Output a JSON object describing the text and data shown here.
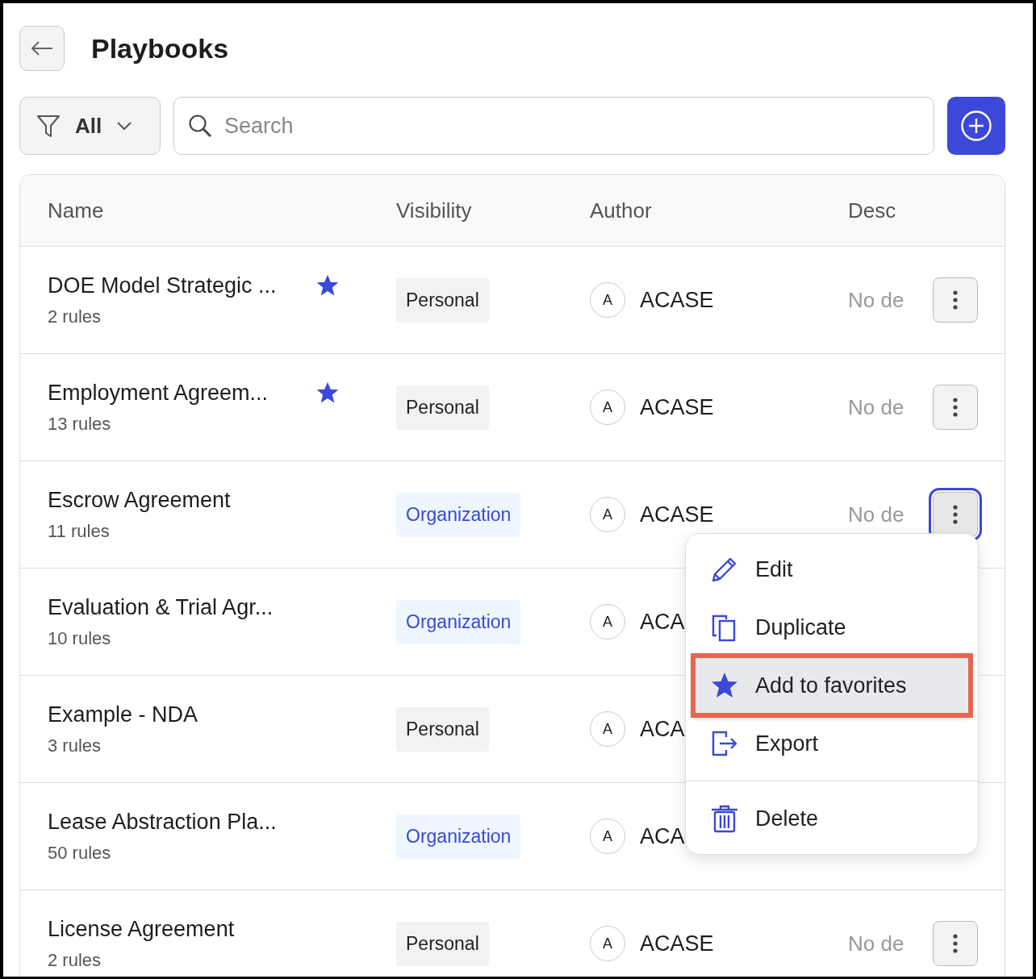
{
  "header": {
    "title": "Playbooks"
  },
  "toolbar": {
    "filter": {
      "label": "All"
    },
    "search": {
      "placeholder": "Search"
    }
  },
  "table": {
    "columns": [
      "Name",
      "Visibility",
      "Author",
      "Desc"
    ],
    "rows": [
      {
        "name": "DOE Model Strategic ...",
        "rules": "2 rules",
        "favorite": true,
        "visibility": {
          "label": "Personal",
          "kind": "personal"
        },
        "avatar": "A",
        "author": "ACASE",
        "description": "No de",
        "menu_button": true,
        "selected": false
      },
      {
        "name": "Employment Agreem...",
        "rules": "13 rules",
        "favorite": true,
        "visibility": {
          "label": "Personal",
          "kind": "personal"
        },
        "avatar": "A",
        "author": "ACASE",
        "description": "No de",
        "menu_button": true,
        "selected": false
      },
      {
        "name": "Escrow Agreement",
        "rules": "11 rules",
        "favorite": false,
        "visibility": {
          "label": "Organization",
          "kind": "organization"
        },
        "avatar": "A",
        "author": "ACASE",
        "description": "No de",
        "menu_button": true,
        "selected": true
      },
      {
        "name": "Evaluation & Trial Agr...",
        "rules": "10 rules",
        "favorite": false,
        "visibility": {
          "label": "Organization",
          "kind": "organization"
        },
        "avatar": "A",
        "author": "ACA",
        "menu_button": false
      },
      {
        "name": "Example - NDA",
        "rules": "3 rules",
        "favorite": false,
        "visibility": {
          "label": "Personal",
          "kind": "personal"
        },
        "avatar": "A",
        "author": "ACA",
        "menu_button": false
      },
      {
        "name": "Lease Abstraction Pla...",
        "rules": "50 rules",
        "favorite": false,
        "visibility": {
          "label": "Organization",
          "kind": "organization"
        },
        "avatar": "A",
        "author": "ACA",
        "menu_button": false
      },
      {
        "name": "License Agreement",
        "rules": "2 rules",
        "favorite": false,
        "visibility": {
          "label": "Personal",
          "kind": "personal"
        },
        "avatar": "A",
        "author": "ACASE",
        "description": "No de",
        "menu_button": true,
        "selected": false
      }
    ]
  },
  "context_menu": {
    "items": [
      {
        "kind": "edit",
        "label": "Edit",
        "highlighted": false
      },
      {
        "kind": "duplicate",
        "label": "Duplicate",
        "highlighted": false
      },
      {
        "kind": "favorite",
        "label": "Add to favorites",
        "highlighted": true
      },
      {
        "kind": "export",
        "label": "Export",
        "highlighted": false
      },
      {
        "kind": "delete",
        "label": "Delete",
        "highlighted": false
      }
    ]
  }
}
